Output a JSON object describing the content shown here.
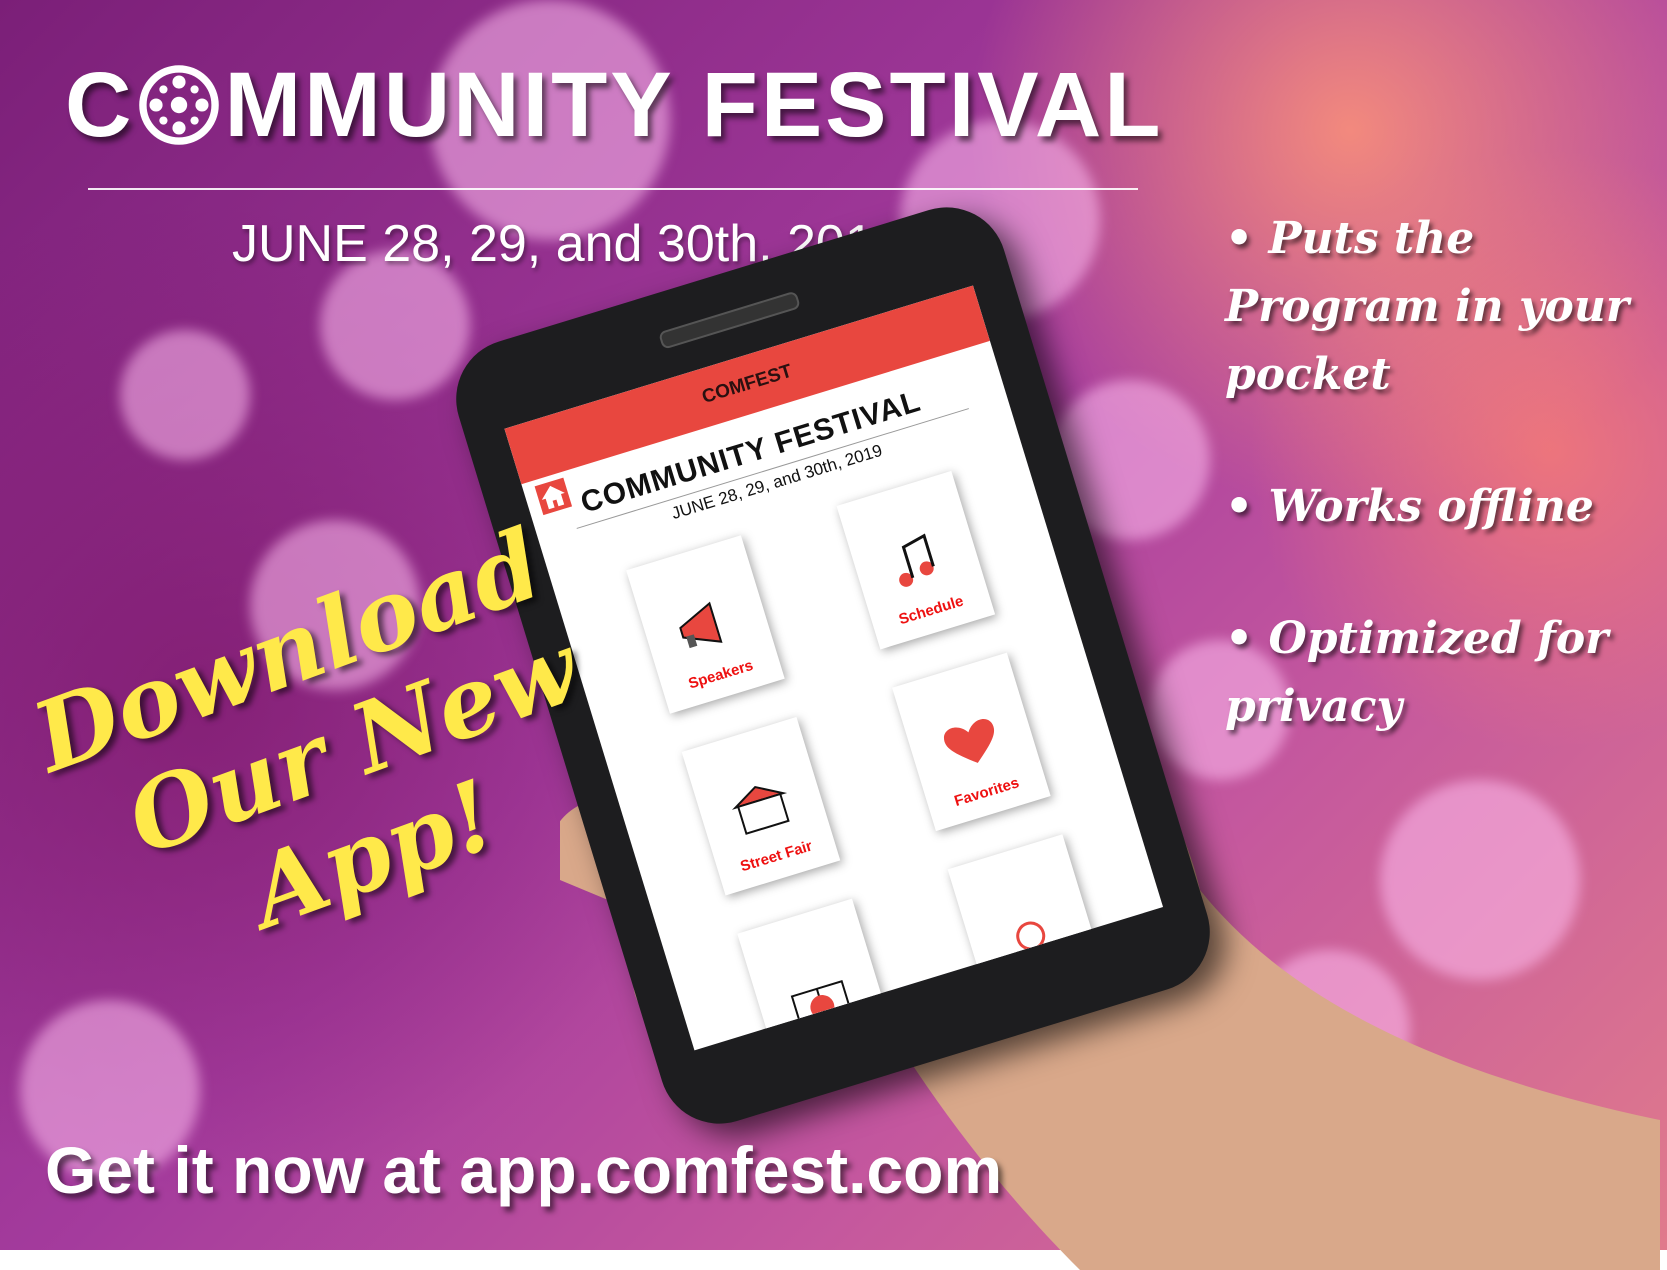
{
  "header": {
    "title_prefix": "C",
    "title_rest": "MMUNITY FESTIVAL",
    "dates": "JUNE 28, 29, and 30th, 2019"
  },
  "features": [
    "• Puts the Program in your pocket",
    "• Works offline",
    "• Optimized for privacy"
  ],
  "promo": {
    "line1": "Download",
    "line2": "Our New",
    "line3": "App!",
    "cta": "Get it now at app.comfest.com"
  },
  "phone_app": {
    "bar_title": "COMFEST",
    "title": "COMMUNITY FESTIVAL",
    "dates": "JUNE 28, 29, and 30th, 2019",
    "tiles": [
      "Speakers",
      "Schedule",
      "Street Fair",
      "Favorites",
      "",
      ""
    ]
  },
  "colors": {
    "accent_red": "#e8473f",
    "promo_yellow": "#ffe94a",
    "background_purple": "#7b1f78"
  }
}
